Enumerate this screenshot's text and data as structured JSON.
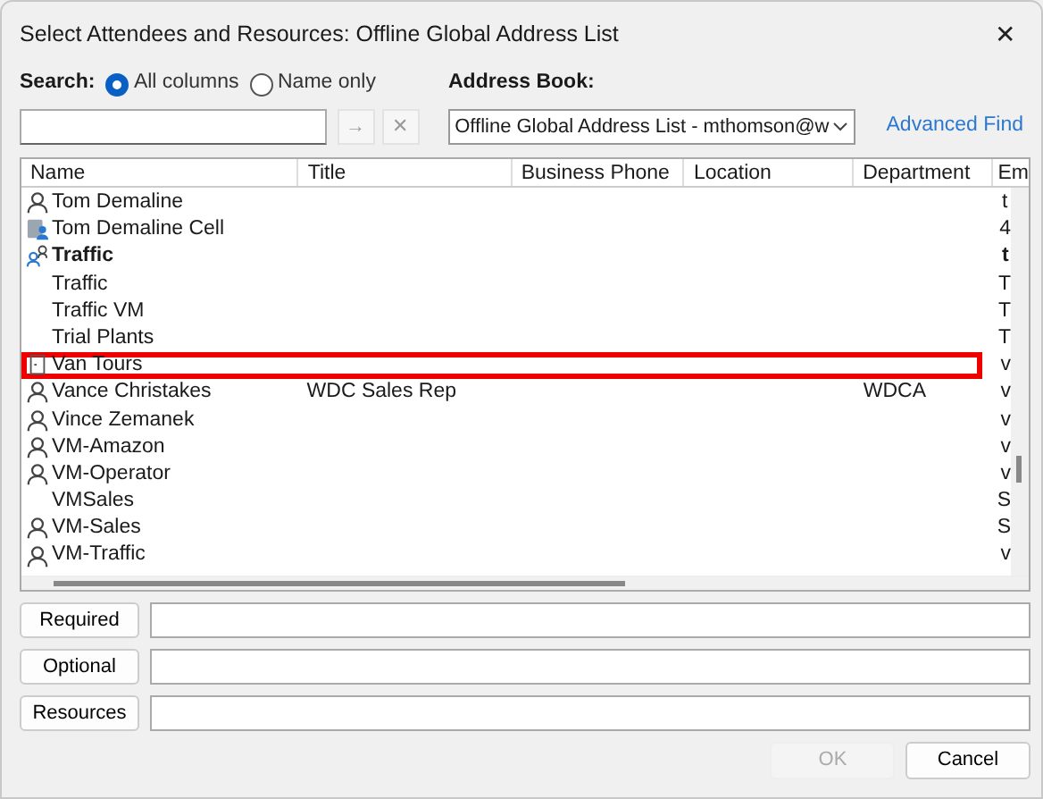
{
  "window": {
    "title": "Select Attendees and Resources: Offline Global Address List",
    "close": "✕"
  },
  "search": {
    "label": "Search:",
    "options": [
      {
        "label": "All columns",
        "selected": true
      },
      {
        "label": "Name only",
        "selected": false
      }
    ],
    "go": "→",
    "clear": "✕"
  },
  "address_book": {
    "label": "Address Book:",
    "value": "Offline Global Address List - mthomson@w",
    "advanced_find": "Advanced Find"
  },
  "table": {
    "columns": [
      "Name",
      "Title",
      "Business Phone",
      "Location",
      "Department",
      "Em"
    ],
    "rows": [
      {
        "kind": "person",
        "name": "Tom Demaline",
        "title": "",
        "department": "",
        "email": "t",
        "highlighted": false
      },
      {
        "kind": "phone-book",
        "name": "Tom Demaline Cell",
        "title": "",
        "department": "",
        "email": "4",
        "highlighted": false
      },
      {
        "kind": "group",
        "name": "Traffic",
        "title": "",
        "department": "",
        "email": "t",
        "highlighted": false
      },
      {
        "kind": "plain",
        "name": "Traffic",
        "title": "",
        "department": "",
        "email": "T",
        "highlighted": false
      },
      {
        "kind": "plain",
        "name": "Traffic VM",
        "title": "",
        "department": "",
        "email": "T",
        "highlighted": false
      },
      {
        "kind": "plain",
        "name": "Trial Plants",
        "title": "",
        "department": "",
        "email": "T",
        "highlighted": false
      },
      {
        "kind": "room",
        "name": "Van Tours",
        "title": "",
        "department": "",
        "email": "v",
        "highlighted": true
      },
      {
        "kind": "person",
        "name": "Vance Christakes",
        "title": "WDC Sales Rep",
        "department": "WDCA",
        "email": "v",
        "highlighted": false
      },
      {
        "kind": "person",
        "name": "Vince Zemanek",
        "title": "",
        "department": "",
        "email": "v",
        "highlighted": false
      },
      {
        "kind": "person",
        "name": "VM-Amazon",
        "title": "",
        "department": "",
        "email": "v",
        "highlighted": false
      },
      {
        "kind": "person",
        "name": "VM-Operator",
        "title": "",
        "department": "",
        "email": "v",
        "highlighted": false
      },
      {
        "kind": "plain",
        "name": "VMSales",
        "title": "",
        "department": "",
        "email": "S",
        "highlighted": false
      },
      {
        "kind": "person",
        "name": "VM-Sales",
        "title": "",
        "department": "",
        "email": "S",
        "highlighted": false
      },
      {
        "kind": "person",
        "name": "VM-Traffic",
        "title": "",
        "department": "",
        "email": "v",
        "highlighted": false
      }
    ]
  },
  "recipients": [
    {
      "label": "Required"
    },
    {
      "label": "Optional"
    },
    {
      "label": "Resources"
    }
  ],
  "buttons": [
    {
      "label": "OK",
      "disabled": true
    },
    {
      "label": "Cancel",
      "disabled": false
    }
  ]
}
